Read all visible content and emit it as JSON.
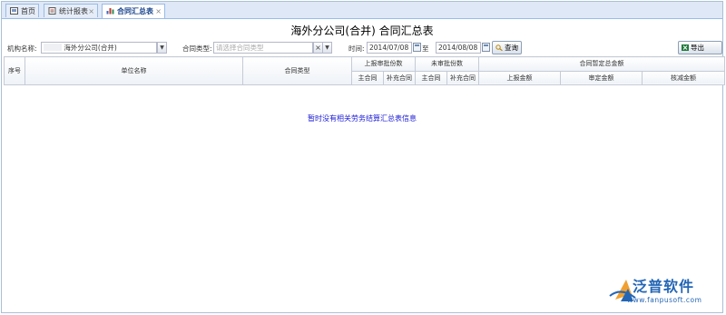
{
  "tabs": [
    {
      "label": "首页",
      "icon": "home-icon",
      "closable": false
    },
    {
      "label": "统计报表",
      "icon": "report-icon",
      "closable": true
    },
    {
      "label": "合同汇总表",
      "icon": "chart-icon",
      "closable": true,
      "active": true
    }
  ],
  "page_title": "海外分公司(合并) 合同汇总表",
  "filters": {
    "org_label": "机构名称:",
    "org_value": "海外分公司(合并)",
    "type_label": "合同类型:",
    "type_placeholder": "请选择合同类型",
    "time_label": "时间:",
    "date_from": "2014/07/08",
    "to_label": "至",
    "date_to": "2014/08/08",
    "query_button": "查询",
    "export_button": "导出Excel"
  },
  "table": {
    "col_index": "序号",
    "col_unit": "单位名称",
    "col_type": "合同类型",
    "group_reported": "上报审批份数",
    "group_unapproved": "未审批份数",
    "group_amount": "合同暂定总金额",
    "sub_main": "主合同",
    "sub_supplement": "补充合同",
    "sub_main2": "主合同",
    "sub_supplement2": "补充合同",
    "sub_reported_amount": "上报金额",
    "sub_approved_amount": "审定金额",
    "sub_reduced_amount": "核减金额"
  },
  "empty_message": "暂时没有相关劳务结算汇总表信息",
  "logo": {
    "name": "泛普软件",
    "url": "www.fanpusoft.com"
  },
  "colors": {
    "tab_bg": "#dfe8f6",
    "border": "#99bbe8",
    "empty_text": "#1a1ad6",
    "logo": "#2466b5"
  }
}
